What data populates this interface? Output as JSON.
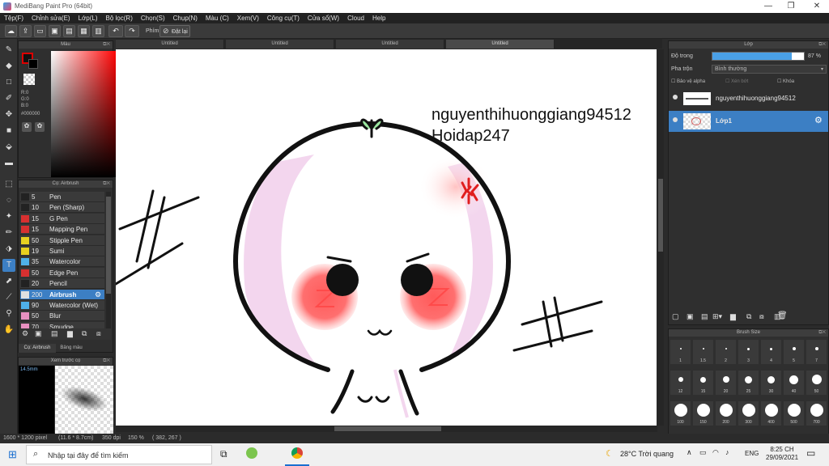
{
  "window": {
    "title": "MediBang Paint Pro (64bit)",
    "min": "—",
    "max": "❐",
    "close": "✕"
  },
  "menu": [
    "Tệp(F)",
    "Chỉnh sửa(E)",
    "Lớp(L)",
    "Bộ lọc(R)",
    "Chọn(S)",
    "Chụp(N)",
    "Màu (C)",
    "Xem(V)",
    "Công cụ(T)",
    "Cửa sổ(W)",
    "Cloud",
    "Help"
  ],
  "toolbar": {
    "key_label": "Phím",
    "reset_label": "Đặt lại"
  },
  "color_panel": {
    "title": "Màu",
    "r": "R:0",
    "g": "G:0",
    "b": "B:0",
    "hex": "#000000"
  },
  "brush_panel": {
    "title": "Cọ: Airbrush",
    "items": [
      {
        "size": "5",
        "name": "Pen",
        "color": "#222222"
      },
      {
        "size": "10",
        "name": "Pen (Sharp)",
        "color": "#222222"
      },
      {
        "size": "15",
        "name": "G Pen",
        "color": "#d73030"
      },
      {
        "size": "15",
        "name": "Mapping Pen",
        "color": "#d73030"
      },
      {
        "size": "50",
        "name": "Stipple Pen",
        "color": "#e8d020"
      },
      {
        "size": "19",
        "name": "Sumi",
        "color": "#e8d020"
      },
      {
        "size": "35",
        "name": "Watercolor",
        "color": "#4fb0e8"
      },
      {
        "size": "50",
        "name": "Edge Pen",
        "color": "#d73030"
      },
      {
        "size": "20",
        "name": "Pencil",
        "color": "#222222"
      },
      {
        "size": "200",
        "name": "Airbrush",
        "color": "#e0e0e0"
      },
      {
        "size": "90",
        "name": "Watercolor (Wet)",
        "color": "#4fb0e8"
      },
      {
        "size": "50",
        "name": "Blur",
        "color": "#e890c0"
      },
      {
        "size": "70",
        "name": "Smudge",
        "color": "#e890c0"
      }
    ],
    "tab1": "Cọ: Airbrush",
    "tab2": "Bảng màu"
  },
  "preview_panel": {
    "title": "Xem trước cọ",
    "size": "14.5mm"
  },
  "tabs": [
    "Untitled",
    "Untitled",
    "Untitled",
    "Untitled"
  ],
  "canvas": {
    "line1": "nguyenthihuonggiang94512",
    "line2": "Hoidap247"
  },
  "layer_panel": {
    "title": "Lớp",
    "opacity_label": "Độ trong",
    "opacity_value": "87 %",
    "opacity": 0.87,
    "blend_label": "Pha trộn",
    "blend_value": "Bình thường",
    "protect_alpha": "Bảo vệ alpha",
    "clipping": "Xén bớt",
    "lock": "Khóa",
    "layers": [
      {
        "name": "nguyenthihuonggiang94512"
      },
      {
        "name": "Lớp1"
      }
    ]
  },
  "brush_size_panel": {
    "title": "Brush Size",
    "sizes": [
      "1",
      "1.5",
      "2",
      "3",
      "4",
      "5",
      "7",
      "12",
      "15",
      "20",
      "25",
      "30",
      "40",
      "50",
      "100",
      "150",
      "200",
      "300",
      "400",
      "500",
      "700"
    ]
  },
  "status": {
    "dims": "1600 * 1200 pixel",
    "cm": "(11.6 * 8.7cm)",
    "dpi": "350 dpi",
    "zoom": "150 %",
    "coords": "( 382, 267 )"
  },
  "taskbar": {
    "search": "Nhập tại đây để tìm kiếm",
    "weather": "28°C  Trời quang",
    "lang": "ENG",
    "time": "8:25 CH",
    "date": "29/09/2021"
  }
}
